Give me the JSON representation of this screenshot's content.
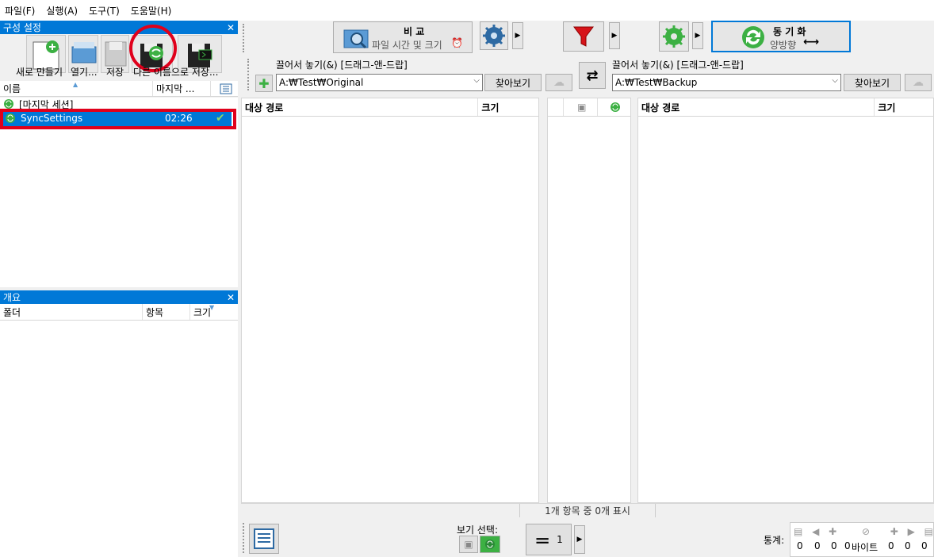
{
  "menu": [
    "파일(F)",
    "실행(A)",
    "도구(T)",
    "도움말(H)"
  ],
  "config_panel": {
    "title": "구성 설정",
    "toolbar": {
      "new_label": "새로 만들기",
      "open_label": "열기...",
      "save_label": "저장",
      "save_as_label": "다른 이름으로 저장...",
      "save_batch_label": ""
    },
    "columns": {
      "name": "이름",
      "last": "마지막 ..."
    },
    "items": [
      {
        "name": "[마지막 세션]",
        "time": ""
      },
      {
        "name": "SyncSettings",
        "time": "02:26"
      }
    ]
  },
  "overview_panel": {
    "title": "개요",
    "columns": {
      "folder": "폴더",
      "items": "항목",
      "size": "크기"
    }
  },
  "toolbar": {
    "compare_title": "비 교",
    "compare_sub": "파일 시간 및 크기",
    "sync_title": "동 기 화",
    "sync_sub": "양방향"
  },
  "left_folder": {
    "dragdrop": "끌어서 놓기(&) [드래그-앤-드랍]",
    "path": "A:₩Test₩Original",
    "browse": "찾아보기"
  },
  "right_folder": {
    "dragdrop": "끌어서 놓기(&) [드래그-앤-드랍]",
    "path": "A:₩Test₩Backup",
    "browse": "찾아보기"
  },
  "grid": {
    "left_path": "대상 경로",
    "left_size": "크기",
    "right_path": "대상 경로",
    "right_size": "크기",
    "status": "1개 항목 중 0개 표시"
  },
  "bottom": {
    "view_select": "보기 선택:",
    "count": "1",
    "stats_label": "통계:",
    "stats": [
      "0",
      "0",
      "0",
      "0",
      "0",
      "0",
      "0"
    ],
    "bytes": "바이트"
  },
  "colors": {
    "accent": "#0078d7",
    "highlight_red": "#e0001b",
    "selected_row": "#0078d7",
    "check_green": "#3cb043"
  }
}
